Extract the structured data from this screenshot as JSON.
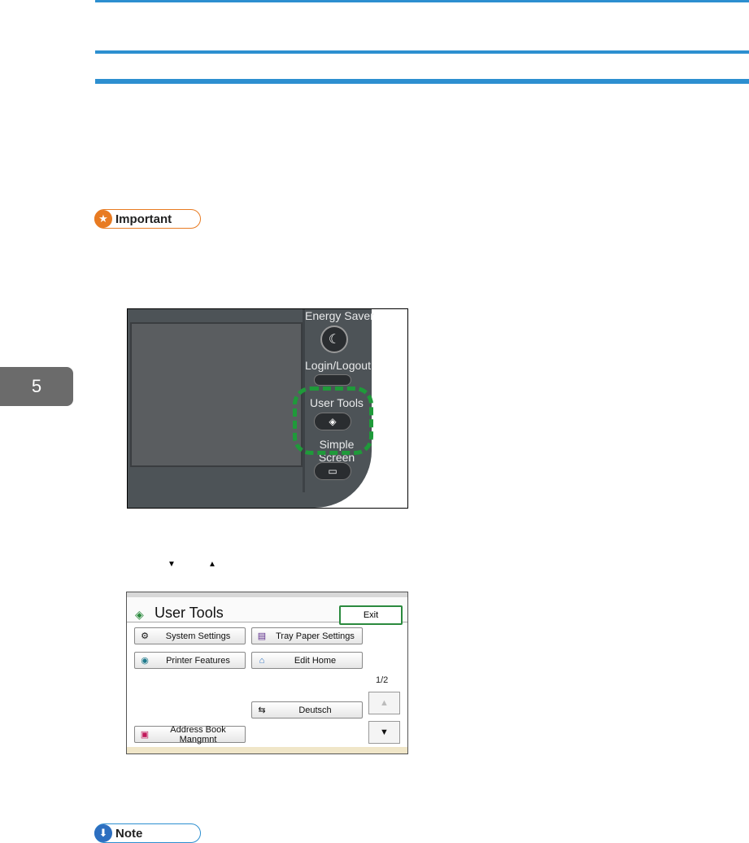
{
  "chapter": {
    "number": "5"
  },
  "important": {
    "label": "Important"
  },
  "note": {
    "label": "Note"
  },
  "panel": {
    "energy_saver": "Energy Saver",
    "login_logout": "Login/Logout",
    "user_tools": "User Tools",
    "simple_screen_1": "Simple",
    "simple_screen_2": "Screen"
  },
  "arrows": {
    "down": "▼",
    "up": "▲"
  },
  "user_tools_screen": {
    "title": "User Tools",
    "exit": "Exit",
    "buttons": [
      {
        "label": "System Settings",
        "icon": "gear-icon"
      },
      {
        "label": "Tray Paper Settings",
        "icon": "tray-paper-icon"
      },
      {
        "label": "Printer Features",
        "icon": "printer-icon"
      },
      {
        "label": "Edit Home",
        "icon": "home-icon"
      },
      {
        "label": "Deutsch",
        "icon": "language-icon"
      },
      {
        "label": "Address Book Mangmnt",
        "icon": "address-book-icon"
      }
    ],
    "page_indicator": "1/2",
    "scroll_up": "▲",
    "scroll_down": "▼"
  }
}
